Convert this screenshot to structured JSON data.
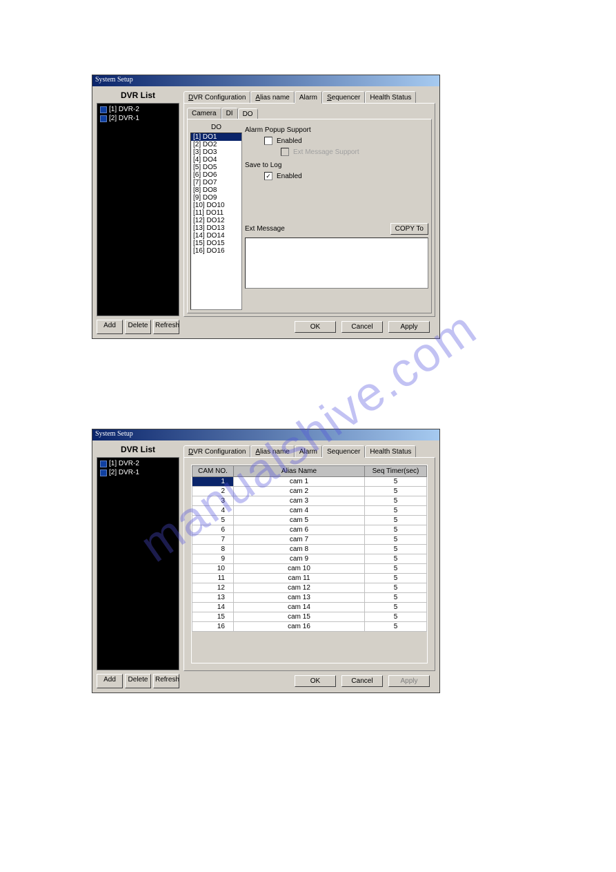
{
  "watermark": "manualshive.com",
  "win1": {
    "title": "System Setup",
    "left_heading": "DVR List",
    "tree": [
      {
        "label": "[1] DVR-2"
      },
      {
        "label": "[2] DVR-1"
      }
    ],
    "buttons": {
      "add": "Add",
      "delete": "Delete",
      "refresh": "Refresh"
    },
    "tabs": {
      "dvr": "DVR Configuration",
      "alias": "Alias name",
      "alarm": "Alarm",
      "seq": "Sequencer",
      "health": "Health Status"
    },
    "subtabs": {
      "camera": "Camera",
      "di": "DI",
      "do": "DO"
    },
    "do_header": "DO",
    "do_items": [
      "[1] DO1",
      "[2] DO2",
      "[3] DO3",
      "[4] DO4",
      "[5] DO5",
      "[6] DO6",
      "[7] DO7",
      "[8] DO8",
      "[9] DO9",
      "[10] DO10",
      "[11] DO11",
      "[12] DO12",
      "[13] DO13",
      "[14] DO14",
      "[15] DO15",
      "[16] DO16"
    ],
    "opt": {
      "alarm_popup": "Alarm Popup Support",
      "enabled": "Enabled",
      "ext_msg_support": "Ext Message Support",
      "save_to_log": "Save to Log",
      "ext_message": "Ext Message",
      "copy_to": "COPY To"
    },
    "footer": {
      "ok": "OK",
      "cancel": "Cancel",
      "apply": "Apply"
    }
  },
  "win2": {
    "title": "System Setup",
    "left_heading": "DVR List",
    "tree": [
      {
        "label": "[1] DVR-2"
      },
      {
        "label": "[2] DVR-1"
      }
    ],
    "buttons": {
      "add": "Add",
      "delete": "Delete",
      "refresh": "Refresh"
    },
    "tabs": {
      "dvr": "DVR Configuration",
      "alias": "Alias name",
      "alarm": "Alarm",
      "seq": "Sequencer",
      "health": "Health Status"
    },
    "table": {
      "headers": {
        "cam": "CAM NO.",
        "alias": "Alias Name",
        "seq": "Seq Timer(sec)"
      },
      "rows": [
        {
          "no": "1",
          "alias": "cam 1",
          "seq": "5"
        },
        {
          "no": "2",
          "alias": "cam 2",
          "seq": "5"
        },
        {
          "no": "3",
          "alias": "cam 3",
          "seq": "5"
        },
        {
          "no": "4",
          "alias": "cam 4",
          "seq": "5"
        },
        {
          "no": "5",
          "alias": "cam 5",
          "seq": "5"
        },
        {
          "no": "6",
          "alias": "cam 6",
          "seq": "5"
        },
        {
          "no": "7",
          "alias": "cam 7",
          "seq": "5"
        },
        {
          "no": "8",
          "alias": "cam 8",
          "seq": "5"
        },
        {
          "no": "9",
          "alias": "cam 9",
          "seq": "5"
        },
        {
          "no": "10",
          "alias": "cam 10",
          "seq": "5"
        },
        {
          "no": "11",
          "alias": "cam 11",
          "seq": "5"
        },
        {
          "no": "12",
          "alias": "cam 12",
          "seq": "5"
        },
        {
          "no": "13",
          "alias": "cam 13",
          "seq": "5"
        },
        {
          "no": "14",
          "alias": "cam 14",
          "seq": "5"
        },
        {
          "no": "15",
          "alias": "cam 15",
          "seq": "5"
        },
        {
          "no": "16",
          "alias": "cam 16",
          "seq": "5"
        }
      ]
    },
    "footer": {
      "ok": "OK",
      "cancel": "Cancel",
      "apply": "Apply"
    }
  }
}
